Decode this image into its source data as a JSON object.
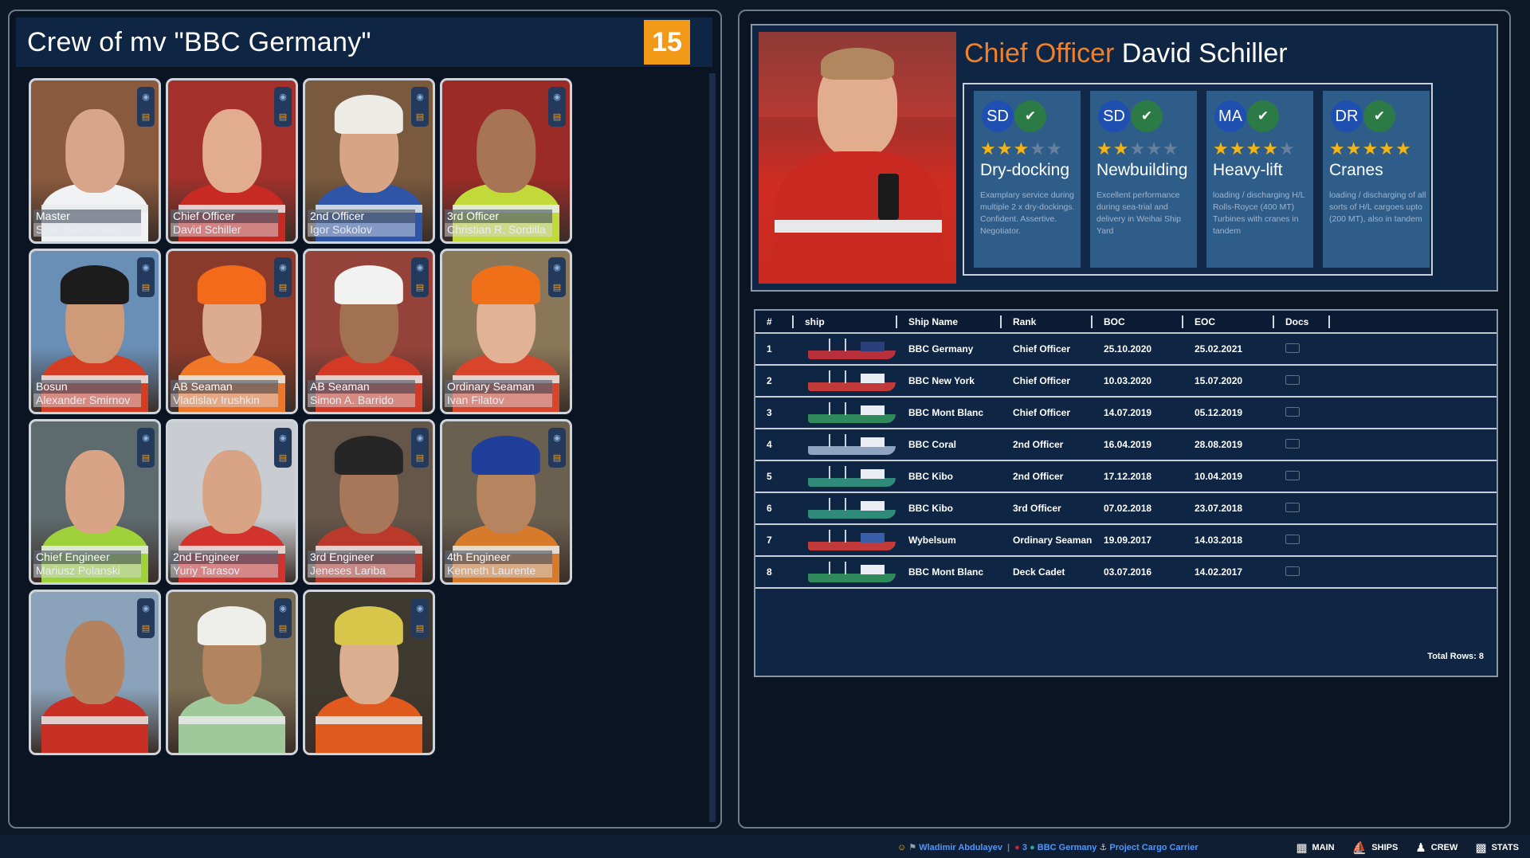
{
  "crew": {
    "title": "Crew of mv \"BBC Germany\"",
    "count": "15",
    "members": [
      {
        "rank": "Master",
        "name": "Scott Brookbanks",
        "bg": "#8a5a3e",
        "skin": "#d9a58a",
        "outfit": "#f1f2f4",
        "headwear": ""
      },
      {
        "rank": "Chief Officer",
        "name": "David Schiller",
        "bg": "#a3302b",
        "skin": "#e2ad8f",
        "outfit": "#c72a22",
        "headwear": ""
      },
      {
        "rank": "2nd Officer",
        "name": "Igor Sokolov",
        "bg": "#7a5a3e",
        "skin": "#d7a585",
        "outfit": "#2f55a8",
        "headwear": "#ecebe6"
      },
      {
        "rank": "3rd Officer",
        "name": "Christian R. Sordilla",
        "bg": "#9b2b27",
        "skin": "#a77556",
        "outfit": "#c2d93a",
        "headwear": ""
      },
      {
        "rank": "Bosun",
        "name": "Alexander Smirnov",
        "bg": "#6a8fb6",
        "skin": "#cf9a78",
        "outfit": "#d43d22",
        "headwear": "#1c1c1c"
      },
      {
        "rank": "AB Seaman",
        "name": "Vladislav Irushkin",
        "bg": "#8a3a2a",
        "skin": "#dcab90",
        "outfit": "#f07727",
        "headwear": "#f26a1a"
      },
      {
        "rank": "AB Seaman",
        "name": "Simon A. Barrido",
        "bg": "#94423a",
        "skin": "#a17152",
        "outfit": "#d23a25",
        "headwear": "#f2f2f2"
      },
      {
        "rank": "Ordinary Seaman",
        "name": "Ivan Filatov",
        "bg": "#8a7658",
        "skin": "#e1b295",
        "outfit": "#d8452a",
        "headwear": "#f07019"
      },
      {
        "rank": "Chief Engineer",
        "name": "Mariusz Polanski",
        "bg": "#5d6a6e",
        "skin": "#d9a486",
        "outfit": "#9fd13a",
        "headwear": ""
      },
      {
        "rank": "2nd Engineer",
        "name": "Yuriy Tarasov",
        "bg": "#c9cdd1",
        "skin": "#d9a386",
        "outfit": "#d2332c",
        "headwear": ""
      },
      {
        "rank": "3rd Engineer",
        "name": "Jeneses Lariba",
        "bg": "#66564a",
        "skin": "#a8775a",
        "outfit": "#b93a2a",
        "headwear": "#262626"
      },
      {
        "rank": "4th Engineer",
        "name": "Kenneth Laurente",
        "bg": "#6a6050",
        "skin": "#b78460",
        "outfit": "#d77b2a",
        "headwear": "#1f3f9a"
      },
      {
        "rank": "",
        "name": "",
        "bg": "#8aa3bb",
        "skin": "#b58260",
        "outfit": "#c83026",
        "headwear": ""
      },
      {
        "rank": "",
        "name": "",
        "bg": "#7a6c52",
        "skin": "#b28460",
        "outfit": "#9fc99a",
        "headwear": "#eeeeea"
      },
      {
        "rank": "",
        "name": "",
        "bg": "#3e3a30",
        "skin": "#dcae90",
        "outfit": "#e05a1e",
        "headwear": "#d8c64a"
      }
    ]
  },
  "profile": {
    "rank": "Chief Officer",
    "name": "David Schiller",
    "skills": [
      {
        "initials": "SD",
        "stars": 3,
        "name": "Dry-docking",
        "desc": "Examplary service during multiple 2 x dry-dockings. Confident. Assertive. Negotiator."
      },
      {
        "initials": "SD",
        "stars": 2,
        "name": "Newbuilding",
        "desc": "Excellent performance during sea-trial and delivery in Weihai Ship Yard"
      },
      {
        "initials": "MA",
        "stars": 4,
        "name": "Heavy-lift",
        "desc": "loading / discharging H/L Rolls-Royce (400 MT) Turbines with cranes in tandem"
      },
      {
        "initials": "DR",
        "stars": 5,
        "name": "Cranes",
        "desc": "loading / discharging of all sorts of H/L cargoes upto (200 MT), also in tandem"
      }
    ]
  },
  "history": {
    "columns": [
      "#",
      "ship",
      "Ship Name",
      "Rank",
      "BOC",
      "EOC",
      "Docs"
    ],
    "rows": [
      {
        "num": "1",
        "ship": "BBC Germany",
        "rank": "Chief Officer",
        "boc": "25.10.2020",
        "eoc": "25.02.2021",
        "hull": "#b8303a",
        "top": "#2a3f7a"
      },
      {
        "num": "2",
        "ship": "BBC New York",
        "rank": "Chief Officer",
        "boc": "10.03.2020",
        "eoc": "15.07.2020",
        "hull": "#c33a3a",
        "top": "#e8eef4"
      },
      {
        "num": "3",
        "ship": "BBC Mont Blanc",
        "rank": "Chief Officer",
        "boc": "14.07.2019",
        "eoc": "05.12.2019",
        "hull": "#2e8a5a",
        "top": "#e8eef4"
      },
      {
        "num": "4",
        "ship": "BBC Coral",
        "rank": "2nd Officer",
        "boc": "16.04.2019",
        "eoc": "28.08.2019",
        "hull": "#8ea4c0",
        "top": "#e8eef4"
      },
      {
        "num": "5",
        "ship": "BBC Kibo",
        "rank": "2nd Officer",
        "boc": "17.12.2018",
        "eoc": "10.04.2019",
        "hull": "#2f8a7a",
        "top": "#e8eef4"
      },
      {
        "num": "6",
        "ship": "BBC Kibo",
        "rank": "3rd Officer",
        "boc": "07.02.2018",
        "eoc": "23.07.2018",
        "hull": "#2f8a7a",
        "top": "#e8eef4"
      },
      {
        "num": "7",
        "ship": "Wybelsum",
        "rank": "Ordinary Seaman",
        "boc": "19.09.2017",
        "eoc": "14.03.2018",
        "hull": "#c23a3a",
        "top": "#3a5ea8"
      },
      {
        "num": "8",
        "ship": "BBC Mont Blanc",
        "rank": "Deck Cadet",
        "boc": "03.07.2016",
        "eoc": "14.02.2017",
        "hull": "#2e8a5a",
        "top": "#e8eef4"
      }
    ],
    "total": "Total Rows: 8"
  },
  "status": {
    "user": "Wladimir Abdulayev",
    "count": "3",
    "ship": "BBC Germany",
    "project": "Project Cargo Carrier"
  },
  "nav": [
    {
      "label": "MAIN",
      "icon": "table-icon"
    },
    {
      "label": "SHIPS",
      "icon": "ship-icon"
    },
    {
      "label": "CREW",
      "icon": "crew-icon"
    },
    {
      "label": "STATS",
      "icon": "chart-icon"
    }
  ]
}
